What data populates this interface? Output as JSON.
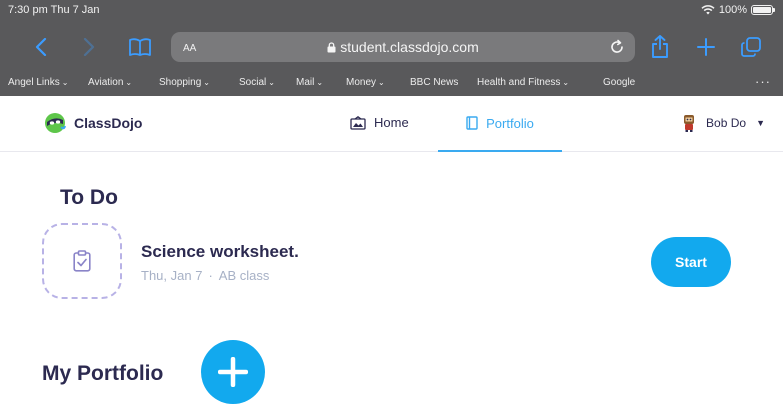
{
  "status_bar": {
    "time": "7:30 pm  Thu 7 Jan",
    "battery": "100%"
  },
  "browser": {
    "text_size_label": "AA",
    "url": "student.classdojo.com",
    "bookmarks": [
      {
        "label": "Angel Links",
        "has_menu": true
      },
      {
        "label": "Aviation",
        "has_menu": true
      },
      {
        "label": "Shopping",
        "has_menu": true
      },
      {
        "label": "Social",
        "has_menu": true
      },
      {
        "label": "Mail",
        "has_menu": true
      },
      {
        "label": "Money",
        "has_menu": true
      },
      {
        "label": "BBC News",
        "has_menu": false
      },
      {
        "label": "Health and Fitness",
        "has_menu": true
      },
      {
        "label": "Google",
        "has_menu": false
      }
    ],
    "more_label": "···",
    "accent_color": "#3b9cff"
  },
  "app": {
    "brand": "ClassDojo",
    "nav": {
      "home": "Home",
      "portfolio": "Portfolio",
      "active": "Portfolio"
    },
    "user": {
      "name": "Bob Do"
    },
    "colors": {
      "primary": "#12a9ee",
      "heading": "#2c2a50",
      "muted": "#a7b1c6",
      "dashed_border": "#b8b2e6"
    }
  },
  "todo": {
    "heading": "To Do",
    "task": {
      "title": "Science worksheet.",
      "date": "Thu, Jan 7",
      "separator": "·",
      "class_name": "AB class",
      "action": "Start"
    }
  },
  "portfolio": {
    "heading": "My Portfolio"
  }
}
